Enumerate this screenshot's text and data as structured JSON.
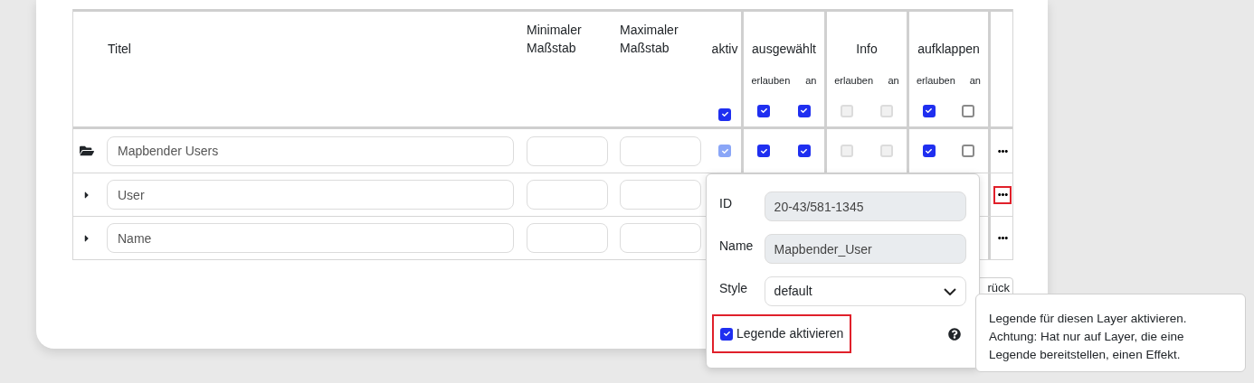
{
  "table": {
    "columns": {
      "title": "Titel",
      "min_scale": "Minimaler Maßstab",
      "max_scale": "Maximaler Maßstab",
      "active": "aktiv",
      "groups": [
        {
          "label": "ausgewählt",
          "sub": [
            "erlauben",
            "an"
          ]
        },
        {
          "label": "Info",
          "sub": [
            "erlauben",
            "an"
          ]
        },
        {
          "label": "aufklappen",
          "sub": [
            "erlauben",
            "an"
          ]
        }
      ]
    },
    "header_checkboxes": [
      {
        "checked": true,
        "disabled": false
      },
      {
        "checked": true,
        "disabled": false
      },
      {
        "checked": true,
        "disabled": false
      },
      {
        "checked": false,
        "disabled": true
      },
      {
        "checked": false,
        "disabled": true
      },
      {
        "checked": true,
        "disabled": false
      },
      {
        "checked": false,
        "disabled": false
      }
    ],
    "rows": [
      {
        "kind": "folder",
        "title": "Mapbender Users",
        "menu_highlighted": false,
        "checkboxes": [
          {
            "checked": true,
            "disabled": true
          },
          {
            "checked": true,
            "disabled": false
          },
          {
            "checked": true,
            "disabled": false
          },
          {
            "checked": false,
            "disabled": true
          },
          {
            "checked": false,
            "disabled": true
          },
          {
            "checked": true,
            "disabled": false
          },
          {
            "checked": false,
            "disabled": false
          }
        ]
      },
      {
        "kind": "caret",
        "title": "User",
        "menu_highlighted": true
      },
      {
        "kind": "caret",
        "title": "Name",
        "menu_highlighted": false
      }
    ]
  },
  "back_button": "rück",
  "popover": {
    "fields": [
      {
        "label": "ID",
        "value": "20-43/581-1345",
        "kind": "readonly"
      },
      {
        "label": "Name",
        "value": "Mapbender_User",
        "kind": "readonly"
      },
      {
        "label": "Style",
        "value": "default",
        "kind": "select"
      }
    ],
    "legend": {
      "label": "Legende aktivieren",
      "checked": true,
      "highlighted": true
    }
  },
  "tooltip": "Legende für diesen Layer aktivieren. Achtung: Hat nur auf Layer, die eine Legende bereitstellen, einen Effekt."
}
